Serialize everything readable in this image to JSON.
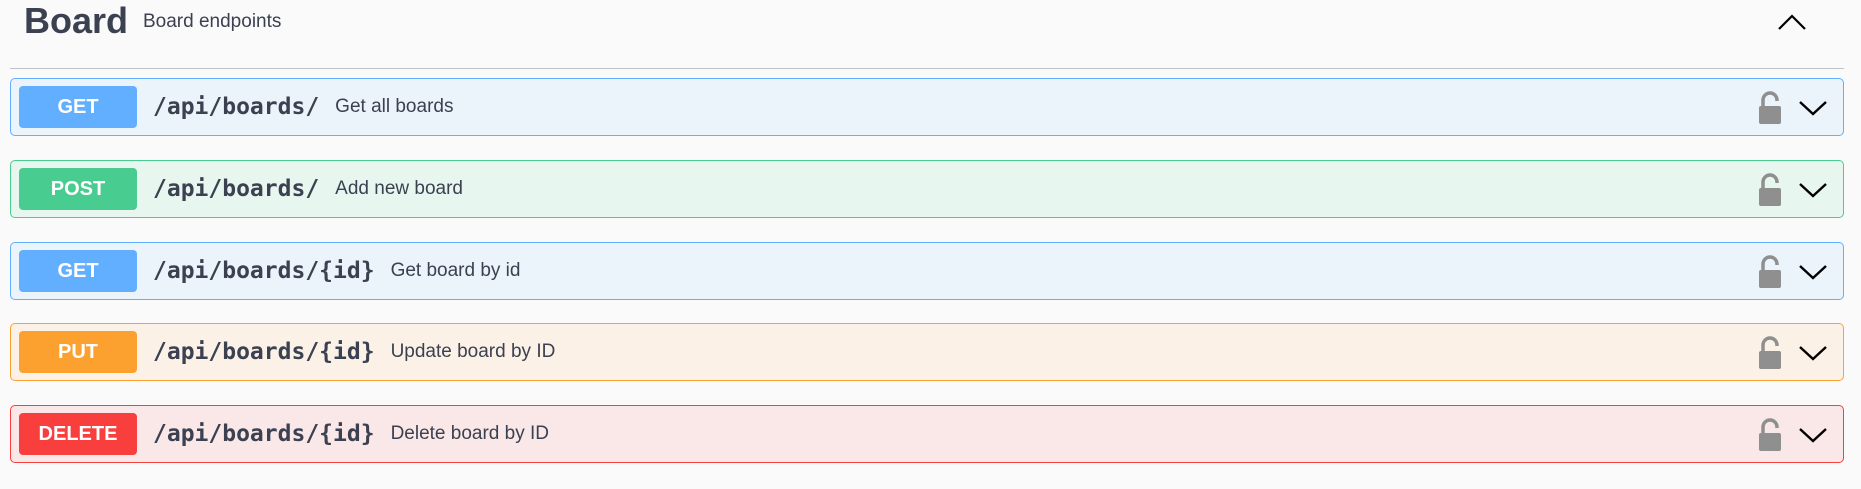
{
  "header": {
    "title": "Board",
    "description": "Board endpoints"
  },
  "operations": [
    {
      "method": "GET",
      "path": "/api/boards/",
      "summary": "Get all boards",
      "method_color": "#61affe",
      "bg_color": "#ebf3fb",
      "border_color": "#61affe"
    },
    {
      "method": "POST",
      "path": "/api/boards/",
      "summary": "Add new board",
      "method_color": "#49cc90",
      "bg_color": "#e8f6f0",
      "border_color": "#49cc90"
    },
    {
      "method": "GET",
      "path": "/api/boards/{id}",
      "summary": "Get board by id",
      "method_color": "#61affe",
      "bg_color": "#ebf3fb",
      "border_color": "#61affe"
    },
    {
      "method": "PUT",
      "path": "/api/boards/{id}",
      "summary": "Update board by ID",
      "method_color": "#fca130",
      "bg_color": "#fbf1e6",
      "border_color": "#fca130"
    },
    {
      "method": "DELETE",
      "path": "/api/boards/{id}",
      "summary": "Delete board by ID",
      "method_color": "#f93e3e",
      "bg_color": "#fae7e7",
      "border_color": "#f93e3e"
    }
  ],
  "icons": {
    "collapse": "chevron-up-icon",
    "lock": "unlocked-padlock-icon",
    "expand": "chevron-down-icon"
  }
}
